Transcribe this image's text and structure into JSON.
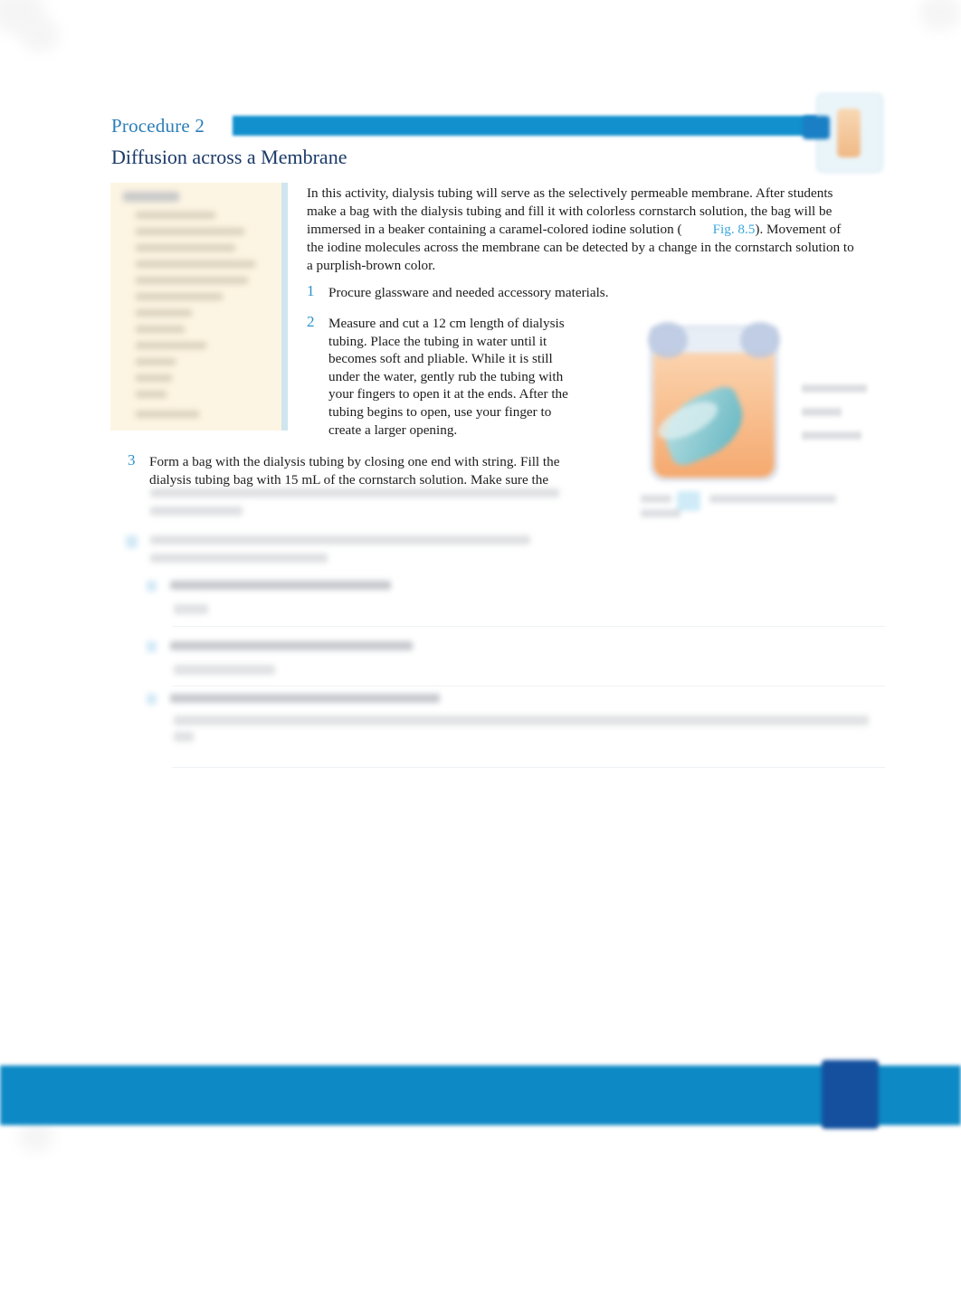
{
  "document": {
    "procedure_label": "Procedure 2",
    "procedure_title": "Diffusion across a Membrane",
    "intro_part1": "In this activity, dialysis tubing will serve as the selectively permeable membrane. After students make a bag with the dialysis tubing and fill it with colorless cornstarch solution, the bag will be immersed in a beaker containing a caramel-colored iodine solution (",
    "figure_link": "Fig. 8.5",
    "intro_part2": "). Movement of the iodine molecules across the membrane can be detected by a change in the cornstarch solution to a purplish-brown color."
  },
  "steps": [
    {
      "number": "1",
      "text": "Procure glassware and needed accessory materials."
    },
    {
      "number": "2",
      "text": "Measure and cut a 12 cm length of dialysis tubing. Place the tubing in water until it becomes soft and pliable. While it is still under the water, gently rub the tubing with your fingers to open it at the ends. After the tubing begins to open, use your finger to create a larger opening."
    },
    {
      "number": "3",
      "text": "Form a bag with the dialysis tubing by closing one end with string. Fill the dialysis tubing bag with 15 mL of the cornstarch solution. Make sure the"
    }
  ],
  "colors": {
    "accent_blue": "#1190cd",
    "heading_navy": "#1b3a68",
    "procedure_label_blue": "#2d7fb8",
    "link_blue": "#38a7de",
    "step_number_blue": "#2b92cf",
    "footer_bar": "#0d89c5",
    "footer_page_box": "#14509e",
    "materials_panel": "#fdf5e3",
    "materials_edge": "#cfe6ef",
    "beaker_liquid": "#f5a96f",
    "dialysis_bag": "#5fb3bf"
  },
  "figure": {
    "alt_description": "Beaker of caramel-colored iodine solution containing a teal dialysis tubing bag"
  }
}
